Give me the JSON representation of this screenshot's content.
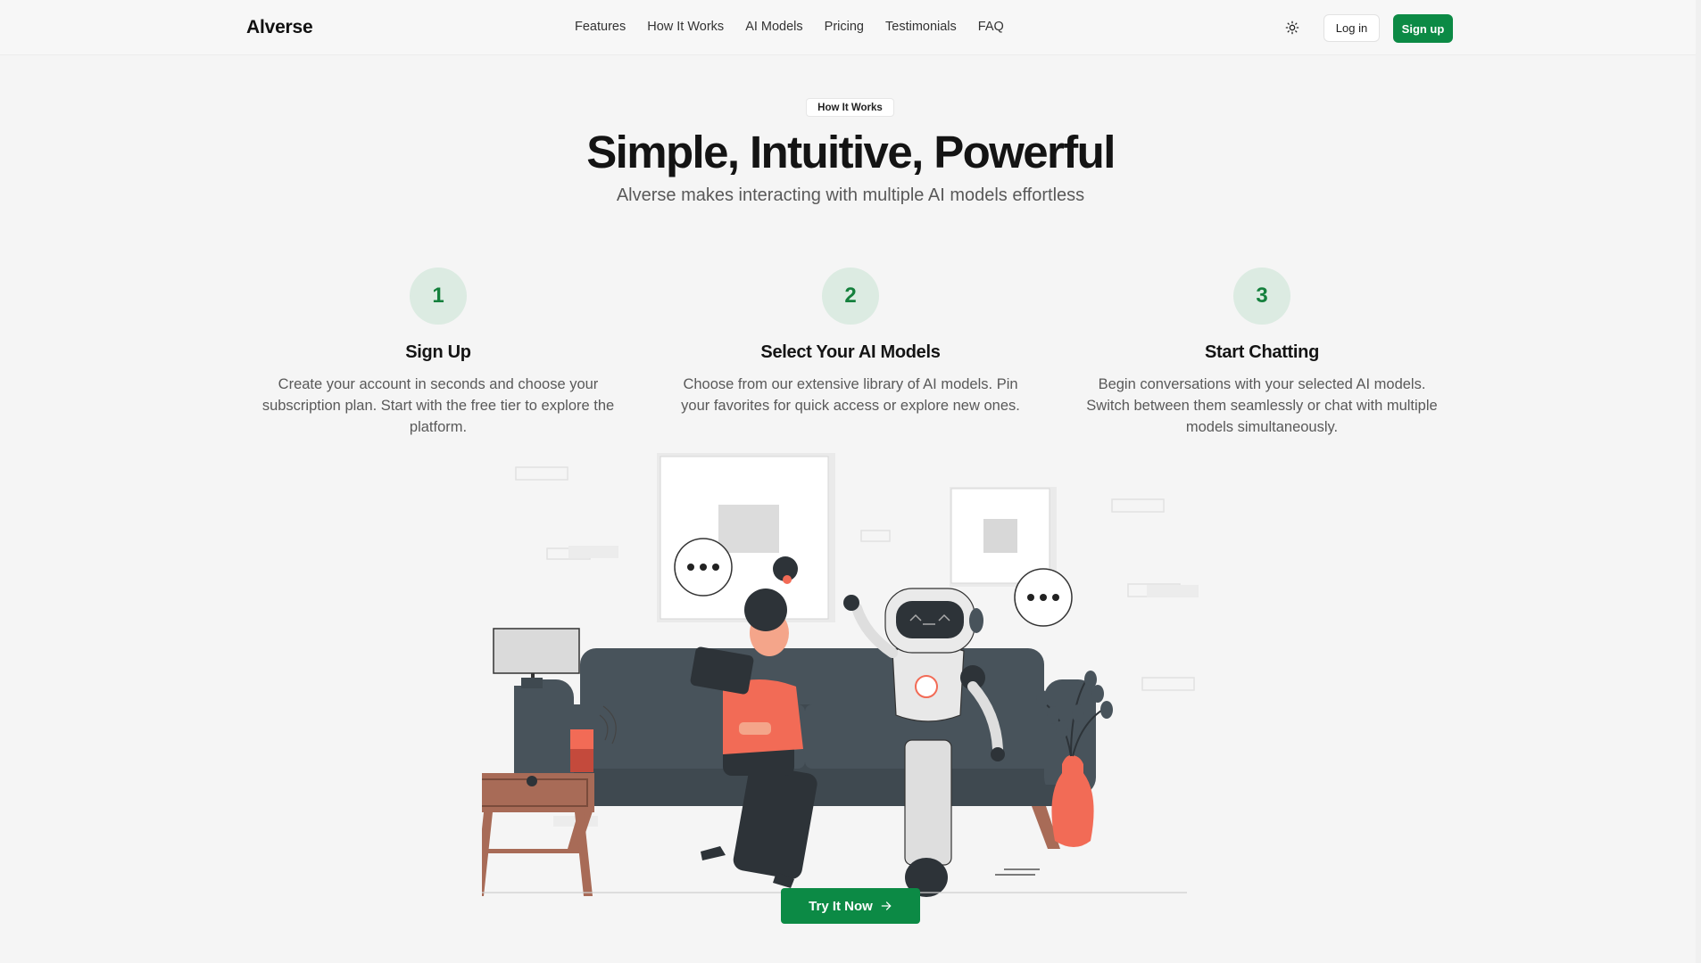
{
  "brand": {
    "name": "Alverse"
  },
  "nav": {
    "items": [
      "Features",
      "How It Works",
      "AI Models",
      "Pricing",
      "Testimonials",
      "FAQ"
    ]
  },
  "header": {
    "theme_icon": "sun-icon",
    "login_label": "Log in",
    "signup_label": "Sign up"
  },
  "hero": {
    "badge": "How It Works",
    "title": "Simple, Intuitive, Powerful",
    "subtitle": "Alverse makes interacting with multiple AI models effortless"
  },
  "steps": [
    {
      "number": "1",
      "title": "Sign Up",
      "description": "Create your account in seconds and choose your subscription plan. Start with the free tier to explore the platform."
    },
    {
      "number": "2",
      "title": "Select Your AI Models",
      "description": "Choose from our extensive library of AI models. Pin your favorites for quick access or explore new ones."
    },
    {
      "number": "3",
      "title": "Start Chatting",
      "description": "Begin conversations with your selected AI models. Switch between them seamlessly or chat with multiple models simultaneously."
    }
  ],
  "cta": {
    "label": "Try It Now",
    "icon": "arrow-right-icon"
  },
  "colors": {
    "accent": "#0c8a45",
    "step_circle": "#dcebe2",
    "step_number": "#15803d",
    "sofa": "#48535b",
    "coral": "#f26b56"
  }
}
